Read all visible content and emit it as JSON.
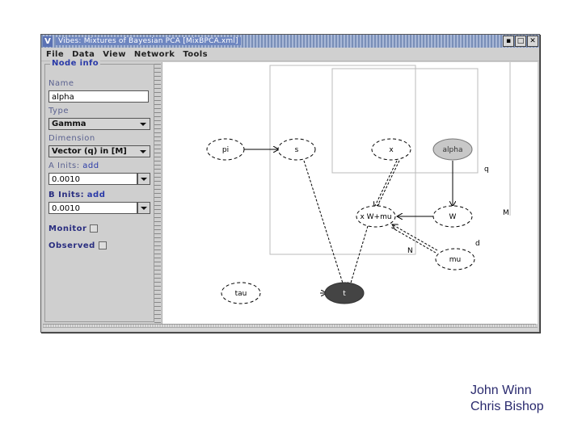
{
  "window": {
    "app_icon": "V",
    "title": "Vibes: Mixtures of Bayesian PCA [MixBPCA.xml]",
    "controls": [
      {
        "name": "minimize-button",
        "icon": "minimize-icon",
        "glyph": "▪"
      },
      {
        "name": "maximize-button",
        "icon": "maximize-icon",
        "glyph": "□"
      },
      {
        "name": "close-button",
        "icon": "close-icon",
        "glyph": "✕"
      }
    ]
  },
  "menubar": {
    "items": [
      "File",
      "Data",
      "View",
      "Network",
      "Tools"
    ]
  },
  "node_info": {
    "legend": "Node info",
    "name_label": "Name",
    "name_value": "alpha",
    "type_label": "Type",
    "type_value": "Gamma",
    "dimension_label": "Dimension",
    "dimension_value": "Vector (q) in [M]",
    "a_inits_label": "A Inits:",
    "a_inits_link": "add",
    "a_inits_value": "0.0010",
    "b_inits_label": "B Inits:",
    "b_inits_link": "add",
    "b_inits_value": "0.0010",
    "monitor_label": "Monitor",
    "monitor_checked": false,
    "observed_label": "Observed",
    "observed_checked": false
  },
  "graph": {
    "nodes": [
      {
        "id": "pi",
        "label": "pi",
        "style": "dashed"
      },
      {
        "id": "s",
        "label": "s",
        "style": "dashed"
      },
      {
        "id": "x",
        "label": "x",
        "style": "dashed"
      },
      {
        "id": "alpha",
        "label": "alpha",
        "style": "selected",
        "fill": "#c8c8c8"
      },
      {
        "id": "xWmu",
        "label": "x W+mu",
        "style": "dashed"
      },
      {
        "id": "W",
        "label": "W",
        "style": "dashed"
      },
      {
        "id": "mu",
        "label": "mu",
        "style": "dashed"
      },
      {
        "id": "tau",
        "label": "tau",
        "style": "dashed"
      },
      {
        "id": "t",
        "label": "t",
        "style": "observed",
        "fill": "#444444"
      }
    ],
    "edges": [
      {
        "from": "pi",
        "to": "s",
        "style": "solid"
      },
      {
        "from": "s",
        "to": "t",
        "style": "dashed"
      },
      {
        "from": "x",
        "to": "xWmu",
        "style": "double"
      },
      {
        "from": "alpha",
        "to": "W",
        "style": "solid"
      },
      {
        "from": "W",
        "to": "xWmu",
        "style": "solid"
      },
      {
        "from": "mu",
        "to": "xWmu",
        "style": "double"
      },
      {
        "from": "xWmu",
        "to": "t",
        "style": "dashed"
      },
      {
        "from": "tau",
        "to": "t",
        "style": "solid"
      }
    ],
    "plates": [
      {
        "label": "N"
      },
      {
        "label": "q"
      },
      {
        "label": "M"
      },
      {
        "label": "d"
      }
    ]
  },
  "credits": {
    "line1": "John Winn",
    "line2": "Chris Bishop"
  }
}
